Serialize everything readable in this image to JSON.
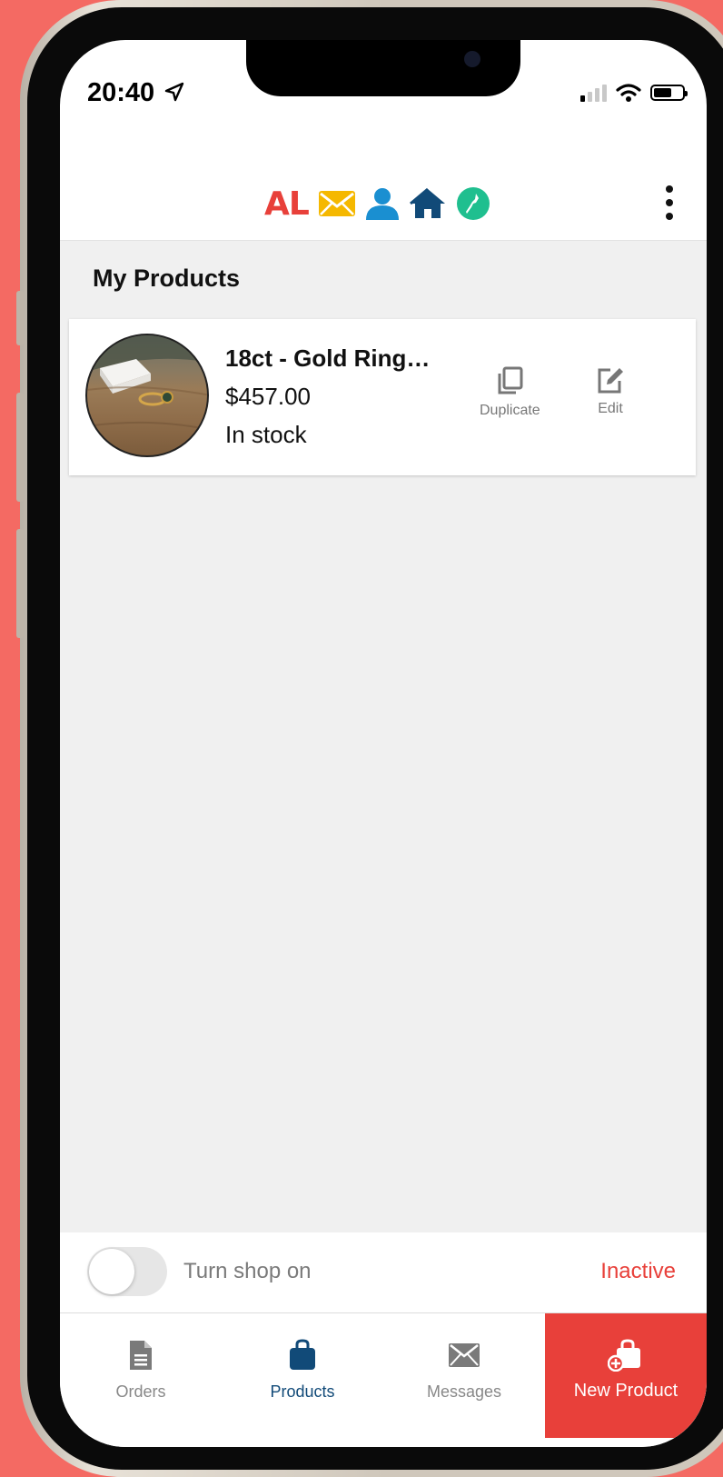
{
  "status_bar": {
    "time": "20:40"
  },
  "header": {
    "logo_text": "AL",
    "icons": [
      "location-arrow-icon",
      "envelope-icon",
      "user-icon",
      "home-icon",
      "nz-map-icon",
      "more-vertical-icon"
    ]
  },
  "page": {
    "title": "My Products"
  },
  "products": [
    {
      "name": "18ct - Gold Ring…",
      "price": "$457.00",
      "stock": "In stock",
      "actions": {
        "duplicate": "Duplicate",
        "edit": "Edit"
      }
    }
  ],
  "shop": {
    "toggle_label": "Turn shop on",
    "status": "Inactive",
    "toggle_on": false
  },
  "tabs": {
    "orders": "Orders",
    "products": "Products",
    "messages": "Messages",
    "new_product": "New Product"
  },
  "colors": {
    "brand_red": "#e8403a",
    "brand_yellow": "#f5b800",
    "brand_blue": "#1a8fd1",
    "brand_navy": "#114a78",
    "brand_green": "#1fbf8f",
    "background": "#f46a63"
  }
}
